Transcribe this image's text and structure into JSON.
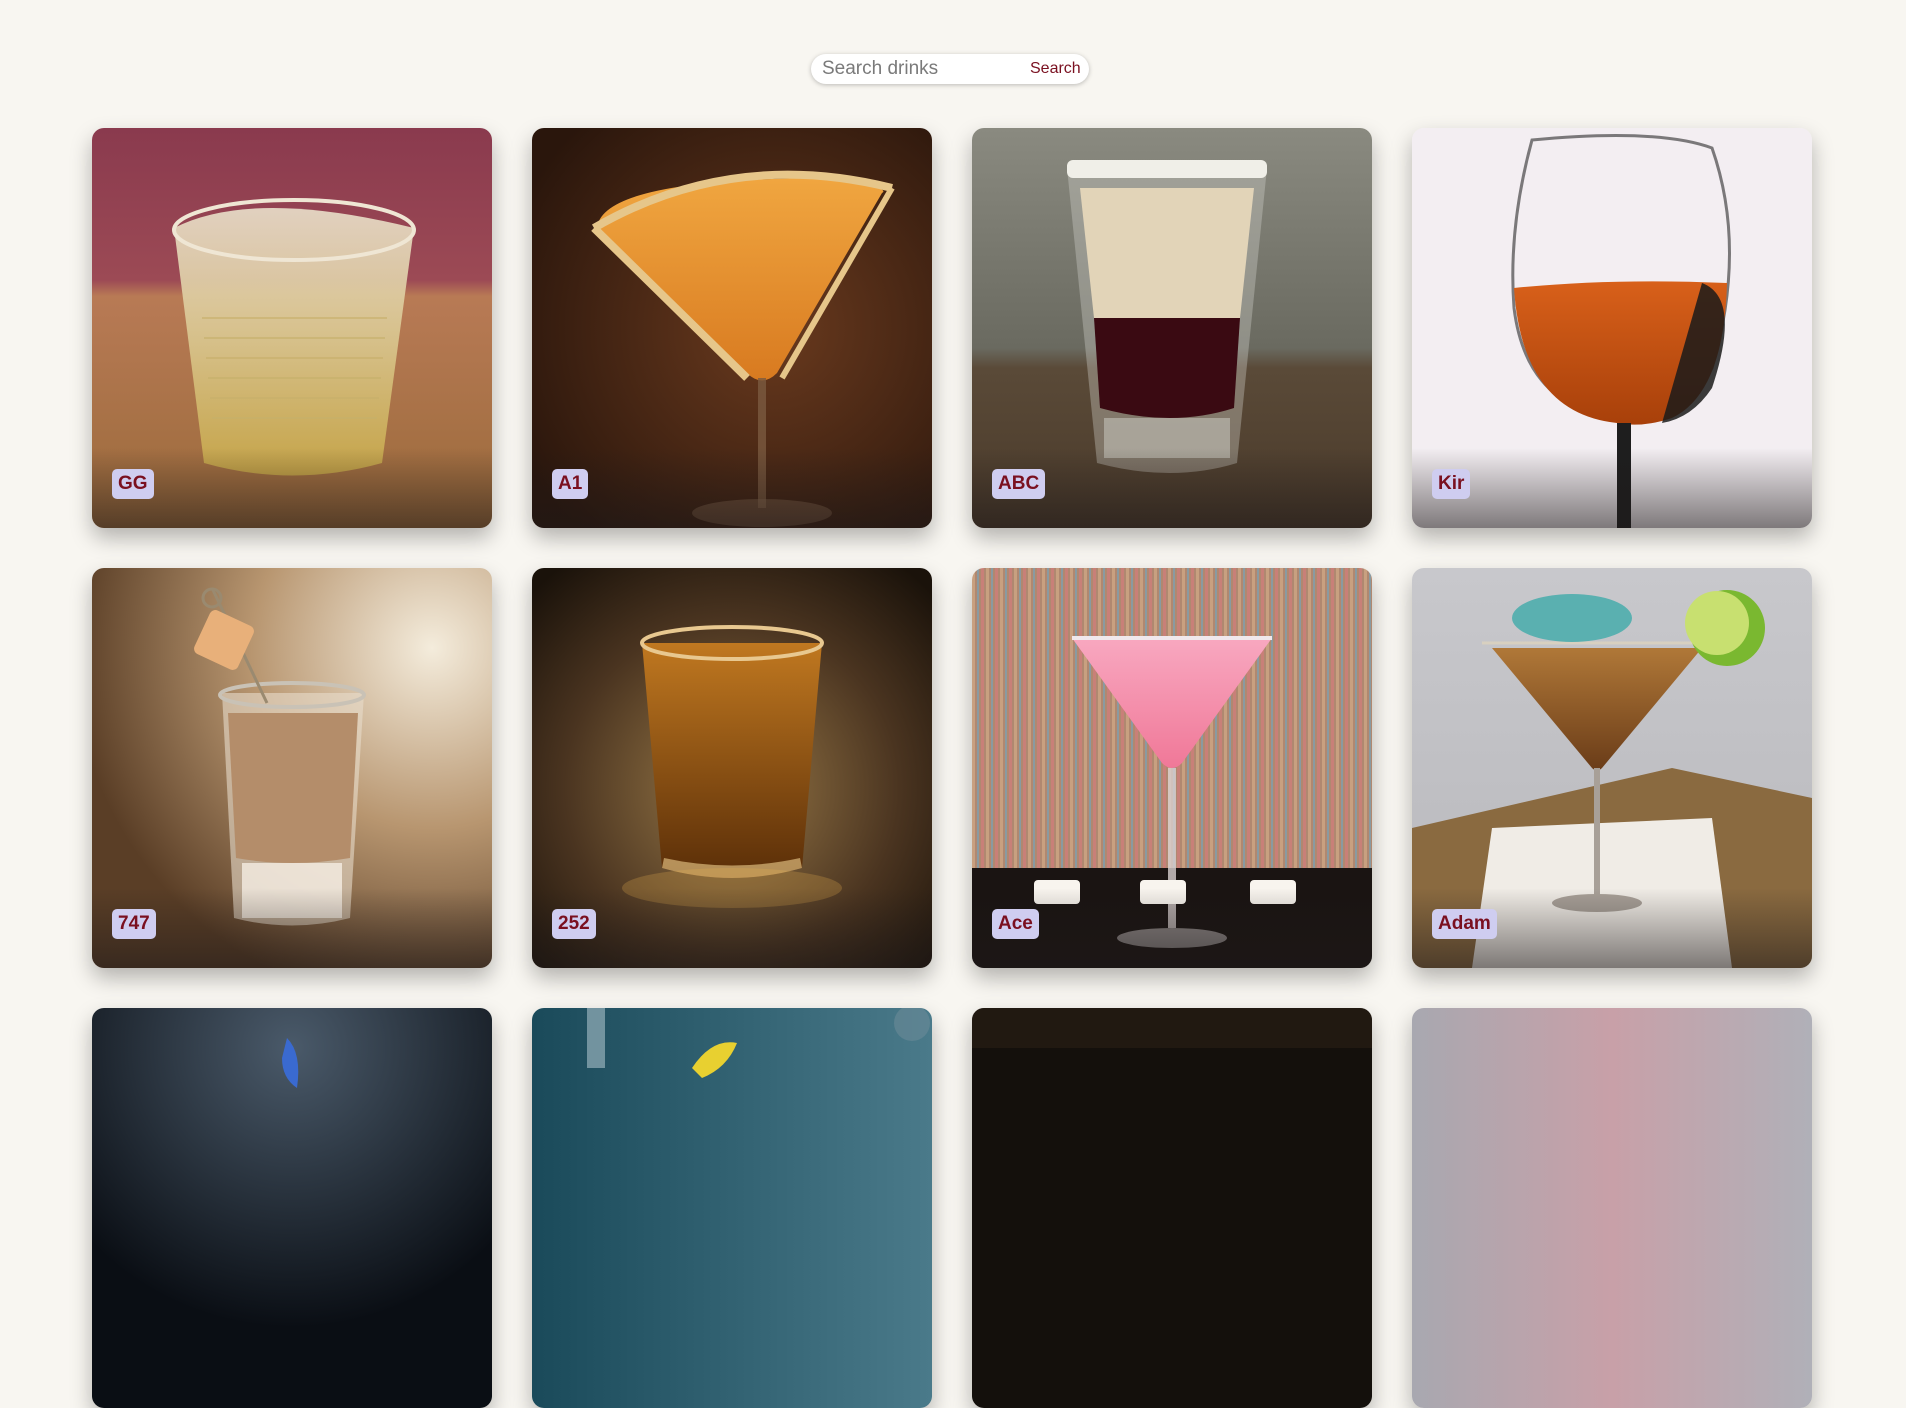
{
  "search": {
    "placeholder": "Search drinks",
    "button_label": "Search"
  },
  "drinks": [
    {
      "name": "GG"
    },
    {
      "name": "A1"
    },
    {
      "name": "ABC"
    },
    {
      "name": "Kir"
    },
    {
      "name": "747"
    },
    {
      "name": "252"
    },
    {
      "name": "Ace"
    },
    {
      "name": "Adam"
    },
    {
      "name": ""
    },
    {
      "name": ""
    },
    {
      "name": ""
    },
    {
      "name": ""
    }
  ],
  "colors": {
    "page_background": "#f8f6f1",
    "label_background": "#cfcdf0",
    "label_text": "#7a1020",
    "search_button_text": "#7a1020"
  }
}
